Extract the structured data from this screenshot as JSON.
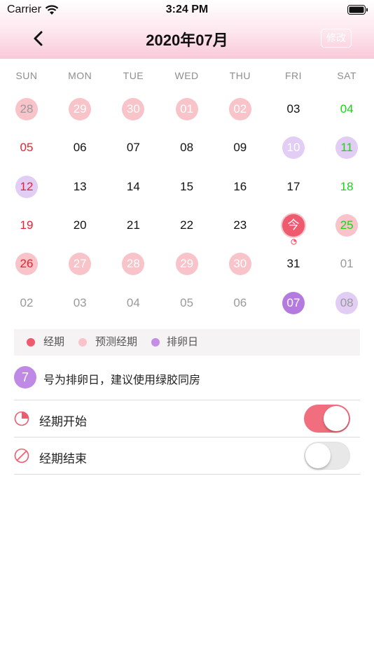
{
  "status_bar": {
    "carrier": "Carrier",
    "time": "3:24 PM"
  },
  "nav": {
    "title": "2020年07月",
    "edit_label": "修改",
    "back_icon": "chevron-left-icon"
  },
  "colors": {
    "period": "#f8c3c9",
    "today": "#f05a6e",
    "ovulation": "#b57ae0",
    "ovulation_light": "#e2cdf5",
    "toggle_on": "#f06e7e"
  },
  "weekdays": [
    "SUN",
    "MON",
    "TUE",
    "WED",
    "THU",
    "FRI",
    "SAT"
  ],
  "calendar": {
    "weeks": [
      [
        {
          "day": "28",
          "style": "period",
          "text": "gray"
        },
        {
          "day": "29",
          "style": "period",
          "text": "white"
        },
        {
          "day": "30",
          "style": "period",
          "text": "white"
        },
        {
          "day": "01",
          "style": "period",
          "text": "white"
        },
        {
          "day": "02",
          "style": "period",
          "text": "white"
        },
        {
          "day": "03",
          "style": "none",
          "text": "black"
        },
        {
          "day": "04",
          "style": "none",
          "text": "green"
        }
      ],
      [
        {
          "day": "05",
          "style": "none",
          "text": "red"
        },
        {
          "day": "06",
          "style": "none",
          "text": "black"
        },
        {
          "day": "07",
          "style": "none",
          "text": "black"
        },
        {
          "day": "08",
          "style": "none",
          "text": "black"
        },
        {
          "day": "09",
          "style": "none",
          "text": "black"
        },
        {
          "day": "10",
          "style": "ovu-light",
          "text": "white"
        },
        {
          "day": "11",
          "style": "ovu-light",
          "text": "green"
        }
      ],
      [
        {
          "day": "12",
          "style": "ovu-light",
          "text": "red"
        },
        {
          "day": "13",
          "style": "none",
          "text": "black"
        },
        {
          "day": "14",
          "style": "none",
          "text": "black"
        },
        {
          "day": "15",
          "style": "none",
          "text": "black"
        },
        {
          "day": "16",
          "style": "none",
          "text": "black"
        },
        {
          "day": "17",
          "style": "none",
          "text": "black"
        },
        {
          "day": "18",
          "style": "none",
          "text": "green"
        }
      ],
      [
        {
          "day": "19",
          "style": "none",
          "text": "red"
        },
        {
          "day": "20",
          "style": "none",
          "text": "black"
        },
        {
          "day": "21",
          "style": "none",
          "text": "black"
        },
        {
          "day": "22",
          "style": "none",
          "text": "black"
        },
        {
          "day": "23",
          "style": "none",
          "text": "black"
        },
        {
          "day": "今",
          "style": "today",
          "text": "white",
          "mark": "period-start-icon"
        },
        {
          "day": "25",
          "style": "period",
          "text": "green"
        }
      ],
      [
        {
          "day": "26",
          "style": "period",
          "text": "red"
        },
        {
          "day": "27",
          "style": "period",
          "text": "white"
        },
        {
          "day": "28",
          "style": "period",
          "text": "white"
        },
        {
          "day": "29",
          "style": "period",
          "text": "white"
        },
        {
          "day": "30",
          "style": "period",
          "text": "white"
        },
        {
          "day": "31",
          "style": "none",
          "text": "black"
        },
        {
          "day": "01",
          "style": "none",
          "text": "gray"
        }
      ],
      [
        {
          "day": "02",
          "style": "none",
          "text": "gray"
        },
        {
          "day": "03",
          "style": "none",
          "text": "gray"
        },
        {
          "day": "04",
          "style": "none",
          "text": "gray"
        },
        {
          "day": "05",
          "style": "none",
          "text": "gray"
        },
        {
          "day": "06",
          "style": "none",
          "text": "gray"
        },
        {
          "day": "07",
          "style": "ovu-dark",
          "text": "white"
        },
        {
          "day": "08",
          "style": "ovu-light",
          "text": "gray"
        }
      ]
    ]
  },
  "legend": {
    "period": "经期",
    "predicted": "预测经期",
    "ovulation": "排卵日"
  },
  "ovulation_note": {
    "badge": "7",
    "text": "号为排卵日，建议使用绿胶同房"
  },
  "settings": {
    "period_start": {
      "label": "经期开始",
      "on": true
    },
    "period_end": {
      "label": "经期结束",
      "on": false
    }
  }
}
